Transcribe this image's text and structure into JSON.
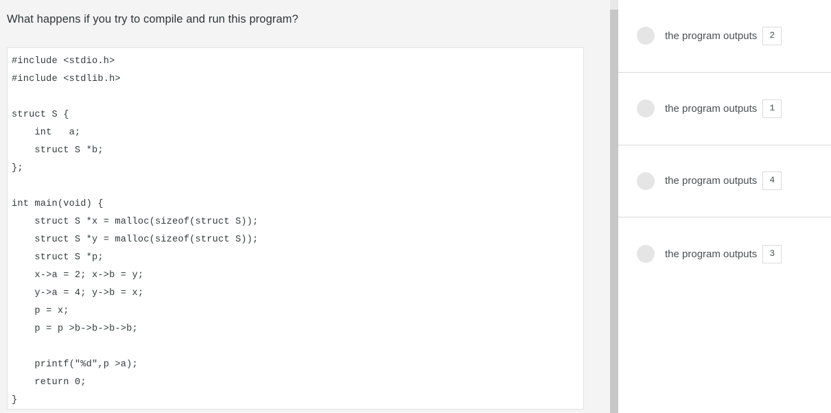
{
  "question": {
    "prompt": "What happens if you try to compile and run this program?",
    "code": "#include <stdio.h>\n#include <stdlib.h>\n\nstruct S {\n    int   a;\n    struct S *b;\n};\n\nint main(void) {\n    struct S *x = malloc(sizeof(struct S));\n    struct S *y = malloc(sizeof(struct S));\n    struct S *p;\n    x->a = 2; x->b = y;\n    y->a = 4; y->b = x;\n    p = x;\n    p = p >b->b->b->b;\n\n    printf(\"%d\",p >a);\n    return 0;\n}"
  },
  "answers": {
    "options": [
      {
        "label": "the program outputs",
        "value": "2"
      },
      {
        "label": "the program outputs",
        "value": "1"
      },
      {
        "label": "the program outputs",
        "value": "4"
      },
      {
        "label": "the program outputs",
        "value": "3"
      }
    ]
  },
  "colors": {
    "page_background": "#f4f4f4",
    "code_background": "#ffffff",
    "panel_background": "#ffffff",
    "divider": "#d9d9d9",
    "radio_fill": "#e5e5e5",
    "scrollbar_track": "#e8e8e8",
    "scrollbar_thumb": "#c7c7c7"
  }
}
